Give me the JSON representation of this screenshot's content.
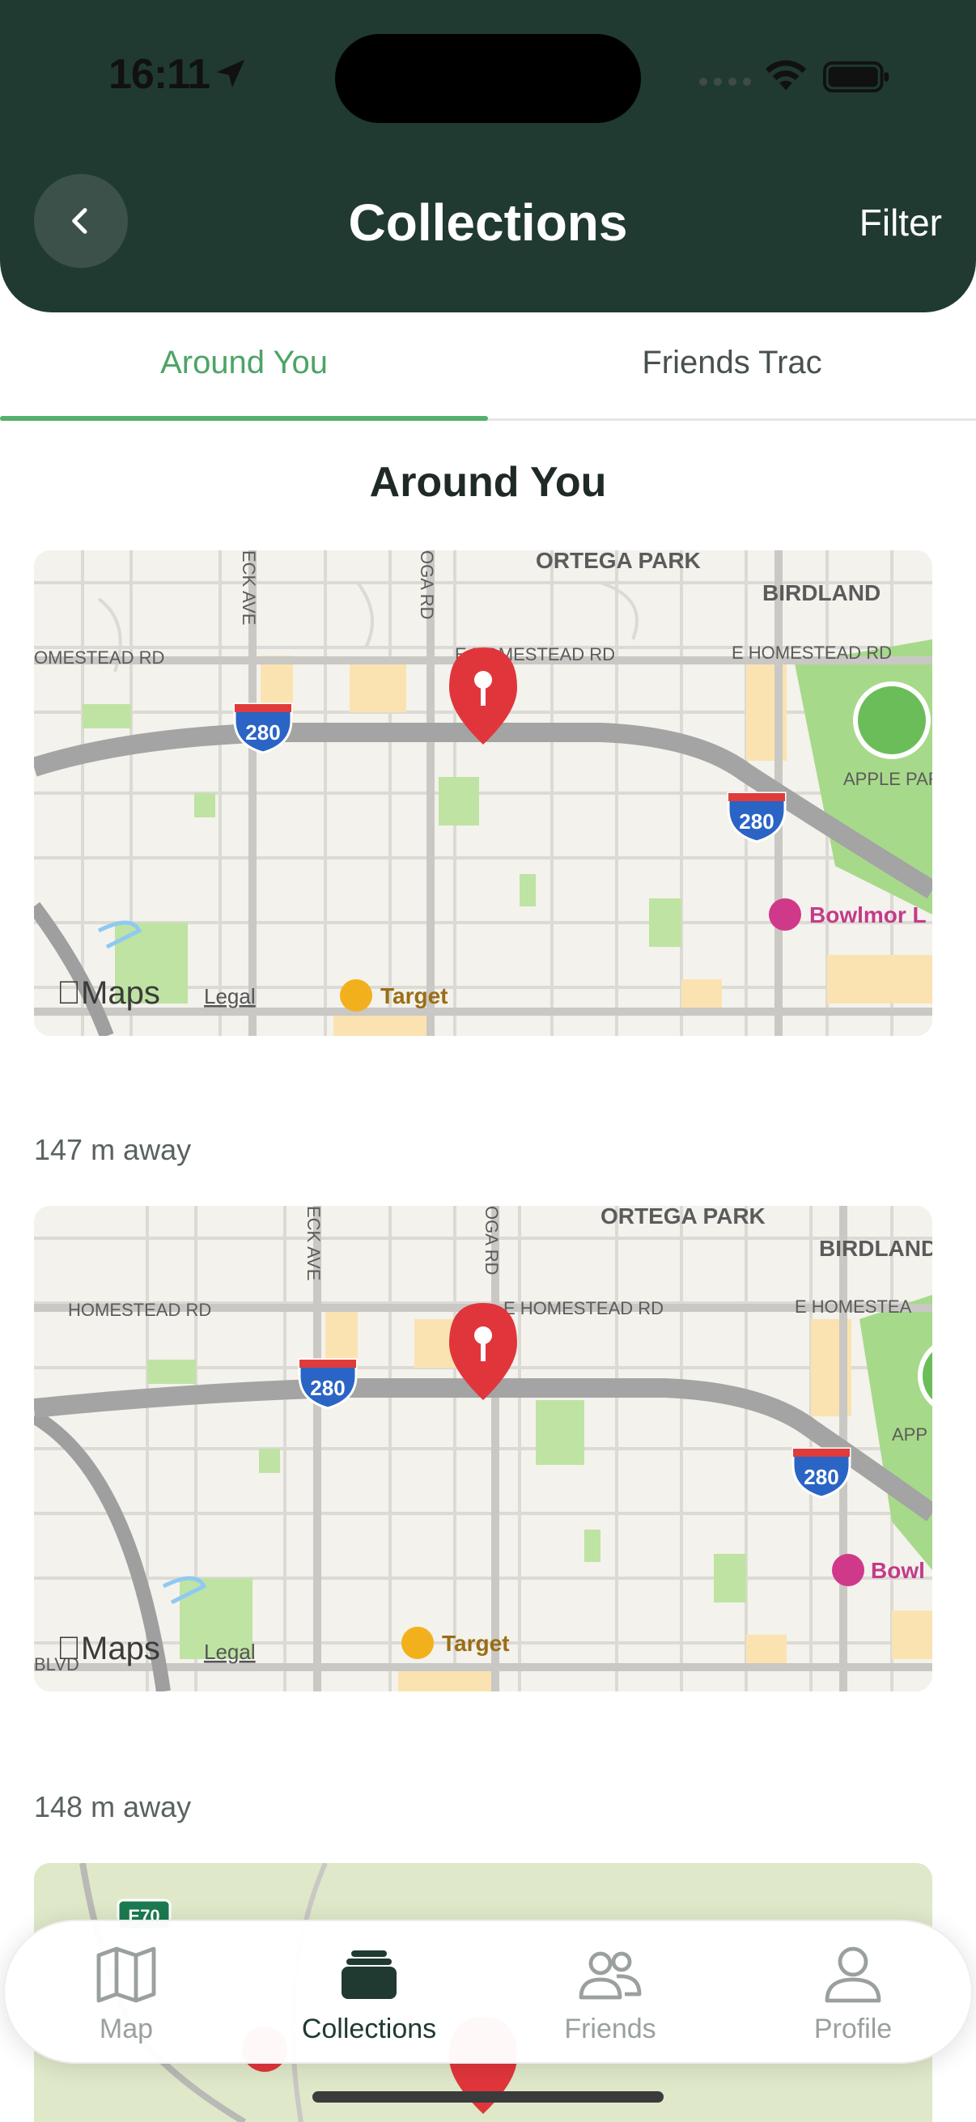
{
  "status_bar": {
    "time": "16:11"
  },
  "header": {
    "title": "Collections",
    "filter_label": "Filter"
  },
  "tabs": [
    {
      "label": "Around You",
      "active": true
    },
    {
      "label": "Friends Trac",
      "active": false
    }
  ],
  "section_title": "Around You",
  "map_labels": {
    "park": "ORTEGA PARK",
    "birdland": "BIRDLAND",
    "homestead": "HOMESTEAD RD",
    "e_homestead": "E HOMESTEAD RD",
    "e_homestead_2": "E HOMESTEAD RD",
    "homestead_cut": "OMESTEAD RD",
    "e_homestea_cut": "E HOMESTEA",
    "eck_ave": "ECK AVE",
    "oga_rd": "OGA RD",
    "interstate": "280",
    "apple_park": "APPLE PAR",
    "apple_park_2": "APP",
    "bowlmor": "Bowlmor L",
    "bowlmor_2": "Bowl",
    "target": "Target",
    "maps_brand": "Maps",
    "legal": "Legal",
    "blvd": "BLVD",
    "highway_shield": "E70"
  },
  "items": [
    {
      "distance": "147 m away"
    },
    {
      "distance": "148 m away"
    }
  ],
  "tabbar": [
    {
      "label": "Map",
      "icon": "map-icon",
      "active": false
    },
    {
      "label": "Collections",
      "icon": "collections-icon",
      "active": true
    },
    {
      "label": "Friends",
      "icon": "friends-icon",
      "active": false
    },
    {
      "label": "Profile",
      "icon": "profile-icon",
      "active": false
    }
  ],
  "colors": {
    "header_bg": "#203a32",
    "accent_green": "#55b06e",
    "pin_red": "#e0363b"
  }
}
